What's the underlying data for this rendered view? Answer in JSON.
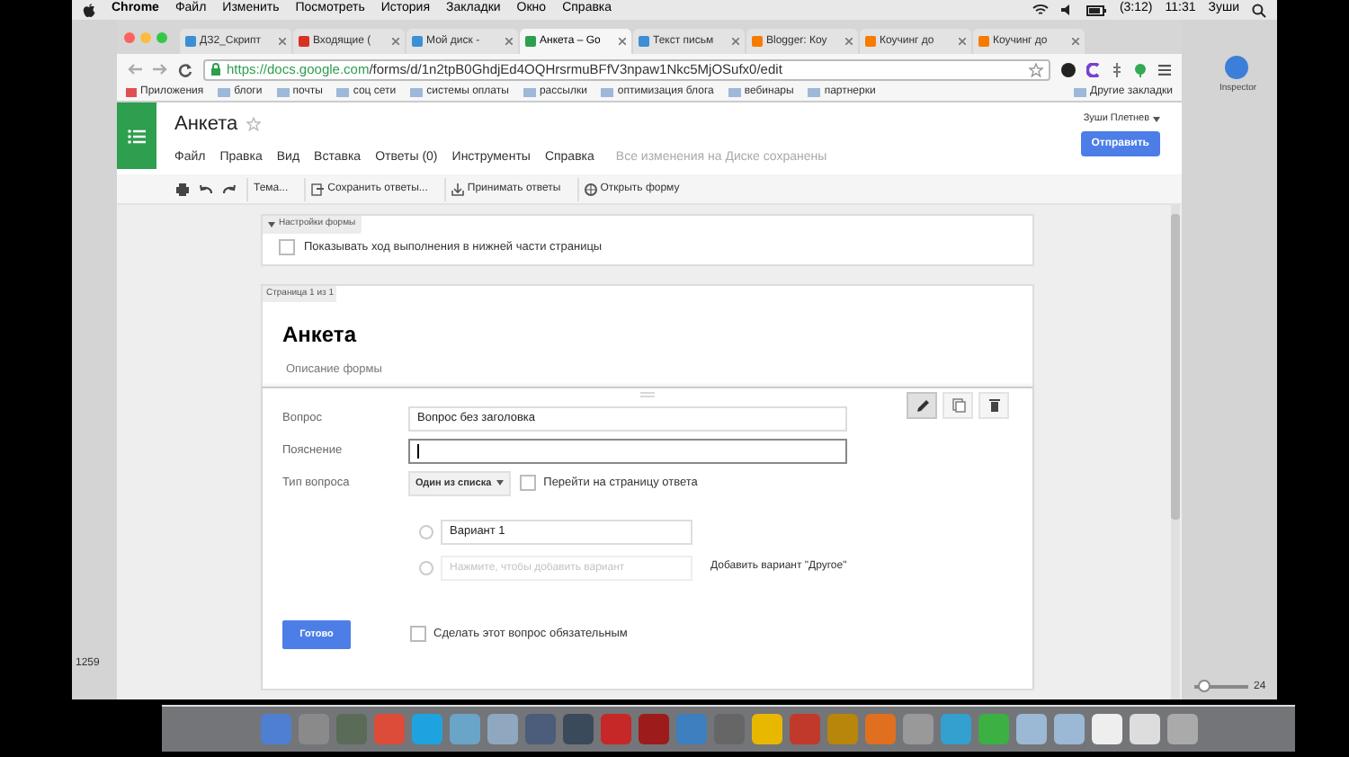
{
  "menu_bar": {
    "app": "Chrome",
    "items": [
      "Файл",
      "Изменить",
      "Посмотреть",
      "История",
      "Закладки",
      "Окно",
      "Справка"
    ],
    "battery_time": "(3:12)",
    "clock": "11:31",
    "user": "Зуши"
  },
  "background_window": {
    "left_label": "1259",
    "right_label": "24",
    "inspector_label": "Inspector",
    "zoom_slider": {
      "level": 0.05
    }
  },
  "browser": {
    "tabs": [
      {
        "label": "ДЗ2_Скрипт",
        "selected": false,
        "color": "#3b8fd6"
      },
      {
        "label": "Входящие (",
        "selected": false,
        "color": "#d93025"
      },
      {
        "label": "Мой диск - ",
        "selected": false,
        "color": "#3b8fd6"
      },
      {
        "label": "Анкета – Go",
        "selected": true,
        "color": "#2e9e4f"
      },
      {
        "label": "Текст письм",
        "selected": false,
        "color": "#3b8fd6"
      },
      {
        "label": "Blogger: Коу",
        "selected": false,
        "color": "#f57c00"
      },
      {
        "label": "Коучинг до",
        "selected": false,
        "color": "#f57c00"
      },
      {
        "label": "Коучинг до",
        "selected": false,
        "color": "#f57c00"
      }
    ],
    "url_host": "https://docs.google.com",
    "url_path": "/forms/d/1n2tpB0GhdjEd4OQHrsrmuBFfV3npaw1Nkc5MjOSufx0/edit",
    "bookmarks": [
      "Приложения",
      "блоги",
      "почты",
      "соц сети",
      "системы оплаты",
      "рассылки",
      "оптимизация блога",
      "вебинары",
      "партнерки"
    ],
    "other_bookmarks": "Другие закладки"
  },
  "docs": {
    "title": "Анкета",
    "menu": [
      "Файл",
      "Правка",
      "Вид",
      "Вставка",
      "Ответы (0)",
      "Инструменты",
      "Справка"
    ],
    "save_status": "Все изменения на Диске сохранены",
    "user": "Зуши Плетнев",
    "send_button": "Отправить",
    "toolbar": [
      "Тема...",
      "Сохранить ответы...",
      "Принимать ответы",
      "Открыть форму"
    ]
  },
  "form_settings": {
    "header": "Настройки формы",
    "expanded": true,
    "progress_option": {
      "label": "Показывать ход выполнения в нижней части страницы",
      "checked": false
    }
  },
  "page": {
    "tab": "Страница 1 из 1",
    "title": "Анкета",
    "description": "Описание формы"
  },
  "question_editor": {
    "tools": [
      {
        "kind": "edit",
        "selected": true
      },
      {
        "kind": "copy",
        "selected": false
      },
      {
        "kind": "delete",
        "selected": false
      }
    ],
    "question_label": "Вопрос",
    "question_value": "Вопрос без заголовка",
    "help_label": "Пояснение",
    "type_label": "Тип вопроса",
    "type_value": "Один из списка",
    "go_to_page": {
      "label": "Перейти на страницу ответа",
      "checked": false
    },
    "options": [
      {
        "value": "Вариант 1",
        "checked": false
      }
    ],
    "add_option": {
      "placeholder": "Нажмите, чтобы добавить вариант",
      "checked": false
    },
    "add_other_link": "Добавить вариант \"Другое\"",
    "done_button": "Готово",
    "required": {
      "label": "Сделать этот вопрос обязательным",
      "checked": false
    }
  }
}
